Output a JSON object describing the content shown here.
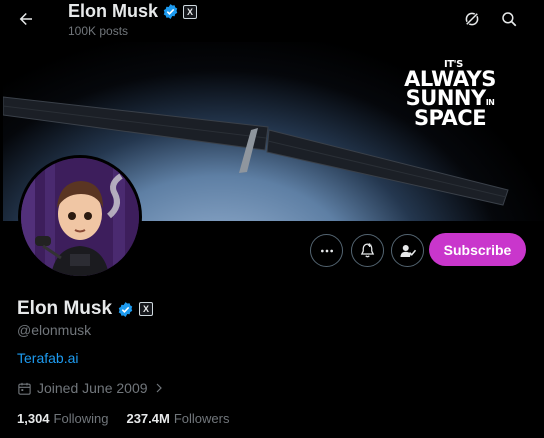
{
  "header": {
    "title": "Elon Musk",
    "post_count": "100K posts"
  },
  "banner": {
    "line1": "IT'S",
    "line2": "ALWAYS",
    "line3": "SUNNY",
    "line3_small": "IN",
    "line4": "SPACE"
  },
  "actions": {
    "subscribe_label": "Subscribe"
  },
  "profile": {
    "name": "Elon Musk",
    "handle": "@elonmusk",
    "website": "Terafab.ai",
    "joined": "Joined June 2009",
    "following_count": "1,304",
    "following_label": "Following",
    "followers_count": "237.4M",
    "followers_label": "Followers"
  },
  "badges": {
    "x_badge": "X"
  },
  "colors": {
    "background": "#000000",
    "accent_blue": "#1d9bf0",
    "subscribe_purple": "#c936cc",
    "muted_text": "#71767b"
  },
  "icons": [
    "back-arrow-icon",
    "grok-icon",
    "search-icon",
    "verified-badge-icon",
    "x-badge-icon",
    "more-icon",
    "notification-bell-icon",
    "following-check-icon",
    "calendar-icon",
    "chevron-right-icon"
  ]
}
